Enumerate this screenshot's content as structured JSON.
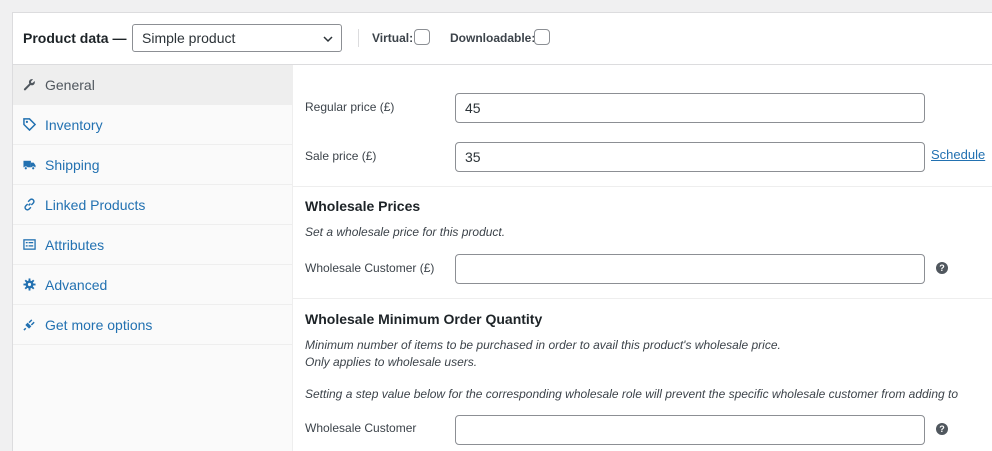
{
  "header": {
    "title": "Product data —",
    "product_type": "Simple product",
    "virtual_label": "Virtual:",
    "downloadable_label": "Downloadable:"
  },
  "sidebar": {
    "items": [
      {
        "label": "General",
        "icon": "wrench-icon",
        "active": true
      },
      {
        "label": "Inventory",
        "icon": "tag-icon"
      },
      {
        "label": "Shipping",
        "icon": "truck-icon"
      },
      {
        "label": "Linked Products",
        "icon": "link-icon"
      },
      {
        "label": "Attributes",
        "icon": "list-icon"
      },
      {
        "label": "Advanced",
        "icon": "gear-icon"
      },
      {
        "label": "Get more options",
        "icon": "plugin-icon"
      }
    ]
  },
  "general": {
    "regular_price_label": "Regular price (£)",
    "regular_price_value": "45",
    "sale_price_label": "Sale price (£)",
    "sale_price_value": "35",
    "schedule_link": "Schedule"
  },
  "wholesale_prices": {
    "title": "Wholesale Prices",
    "description": "Set a wholesale price for this product.",
    "field_label": "Wholesale Customer (£)",
    "field_value": ""
  },
  "wholesale_moq": {
    "title": "Wholesale Minimum Order Quantity",
    "description_line1": "Minimum number of items to be purchased in order to avail this product's wholesale price.",
    "description_line2": "Only applies to wholesale users.",
    "description_line3": "Setting a step value below for the corresponding wholesale role will prevent the specific wholesale customer from adding to",
    "field_label": "Wholesale Customer",
    "field_value": ""
  },
  "help_icon_glyph": "?",
  "colors": {
    "link": "#2271b1",
    "border": "#8c8f94",
    "active_tab_bg": "#eeeeee"
  }
}
